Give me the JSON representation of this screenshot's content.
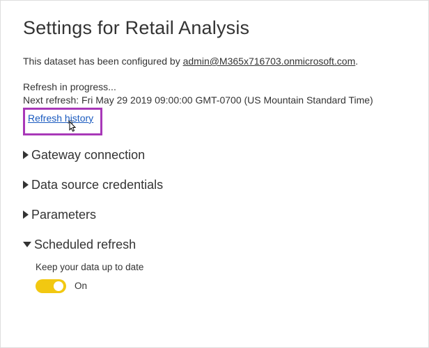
{
  "page_title": "Settings for Retail Analysis",
  "config_line_prefix": "This dataset has been configured by ",
  "config_email": "admin@M365x716703.onmicrosoft.com",
  "config_line_suffix": ".",
  "status": {
    "progress": "Refresh in progress...",
    "next": "Next refresh: Fri May 29 2019 09:00:00 GMT-0700 (US Mountain Standard Time)",
    "history_link": "Refresh history"
  },
  "sections": {
    "gateway": "Gateway connection",
    "datasource": "Data source credentials",
    "parameters": "Parameters",
    "scheduled": "Scheduled refresh"
  },
  "scheduled_refresh": {
    "keep_label": "Keep your data up to date",
    "toggle_state": "On"
  }
}
